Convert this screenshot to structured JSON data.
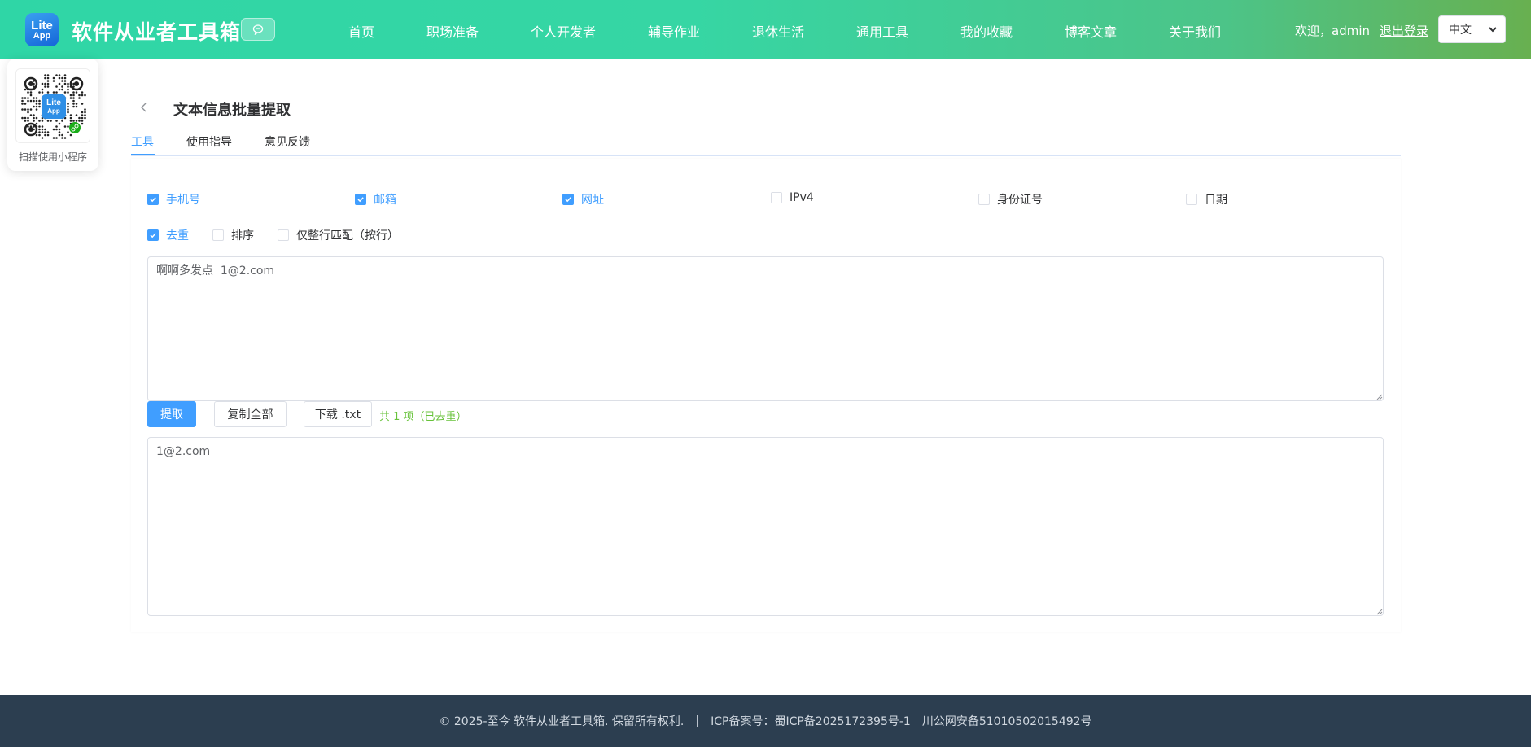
{
  "header": {
    "logo_line1": "Lite",
    "logo_line2": "App",
    "site_title": "软件从业者工具箱",
    "nav": [
      {
        "label": "首页"
      },
      {
        "label": "职场准备"
      },
      {
        "label": "个人开发者"
      },
      {
        "label": "辅导作业"
      },
      {
        "label": "退休生活"
      },
      {
        "label": "通用工具"
      },
      {
        "label": "我的收藏"
      },
      {
        "label": "博客文章"
      },
      {
        "label": "关于我们"
      }
    ],
    "welcome": "欢迎，admin",
    "logout": "退出登录",
    "language": "中文"
  },
  "qr": {
    "caption": "扫描使用小程序",
    "logo_line1": "Lite",
    "logo_line2": "App"
  },
  "page": {
    "title": "文本信息批量提取",
    "tabs": [
      {
        "label": "工具",
        "active": true
      },
      {
        "label": "使用指导",
        "active": false
      },
      {
        "label": "意见反馈",
        "active": false
      }
    ]
  },
  "options": {
    "types": [
      {
        "label": "手机号",
        "checked": true
      },
      {
        "label": "邮箱",
        "checked": true
      },
      {
        "label": "网址",
        "checked": true
      },
      {
        "label": "IPv4",
        "checked": false
      },
      {
        "label": "身份证号",
        "checked": false
      },
      {
        "label": "日期",
        "checked": false
      }
    ],
    "flags": [
      {
        "label": "去重",
        "checked": true
      },
      {
        "label": "排序",
        "checked": false
      },
      {
        "label": "仅整行匹配（按行）",
        "checked": false
      }
    ]
  },
  "input_text": "啊啊多发点  1@2.com",
  "actions": {
    "extract": "提取",
    "copy_all": "复制全部",
    "download": "下载 .txt",
    "result_count": "共 1 项（已去重）"
  },
  "output_text": "1@2.com",
  "footer": {
    "copyright": "© 2025-至今 软件从业者工具箱. 保留所有权利.",
    "separator": "|",
    "icp": "ICP备案号：蜀ICP备2025172395号-1",
    "police": "川公网安备51010502015492号"
  },
  "colors": {
    "accent": "#409eff",
    "success": "#67c23a",
    "footer_bg": "#2c3e50",
    "header_gradient_start": "#2fd6a6",
    "header_gradient_end": "#68b050"
  }
}
